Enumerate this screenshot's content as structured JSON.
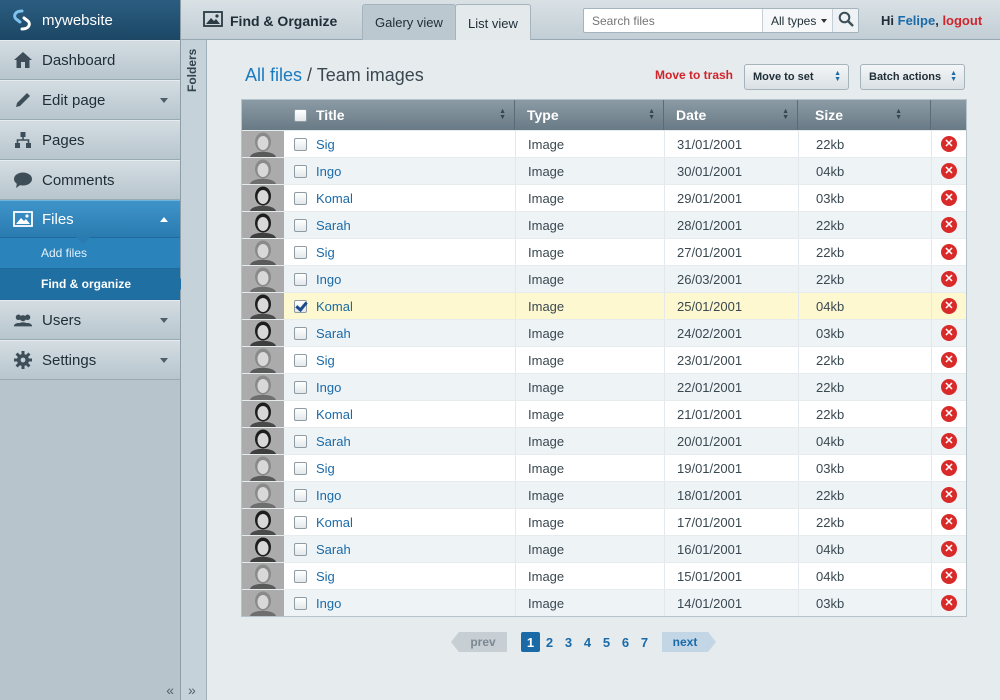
{
  "brand": {
    "name": "mywebsite"
  },
  "sidebar": {
    "items": [
      {
        "label": "Dashboard",
        "icon": "home-icon"
      },
      {
        "label": "Edit page",
        "icon": "pencil-icon"
      },
      {
        "label": "Pages",
        "icon": "sitemap-icon"
      },
      {
        "label": "Comments",
        "icon": "comment-icon"
      },
      {
        "label": "Files",
        "icon": "image-icon"
      },
      {
        "label": "Users",
        "icon": "users-icon"
      },
      {
        "label": "Settings",
        "icon": "gear-icon"
      }
    ],
    "files_sub": [
      {
        "label": "Add files"
      },
      {
        "label": "Find & organize"
      }
    ]
  },
  "folders": {
    "label": "Folders"
  },
  "header": {
    "title": "Find & Organize",
    "tab_gallery": "Galery view",
    "tab_list": "List view",
    "search_placeholder": "Search files",
    "type_select": "All types",
    "greeting_prefix": "Hi ",
    "user": "Felipe",
    "separator": ", ",
    "logout": "logout"
  },
  "main": {
    "breadcrumb_root": "All files",
    "breadcrumb_sep": " / ",
    "breadcrumb_current": "Team images",
    "move_trash": "Move to trash",
    "move_set": "Move to set",
    "batch_actions": "Batch actions"
  },
  "table": {
    "columns": [
      "Title",
      "Type",
      "Date",
      "Size"
    ],
    "rows": [
      {
        "title": "Sig",
        "type": "Image",
        "date": "31/01/2001",
        "size": "22kb",
        "checked": false
      },
      {
        "title": "Ingo",
        "type": "Image",
        "date": "30/01/2001",
        "size": "04kb",
        "checked": false
      },
      {
        "title": "Komal",
        "type": "Image",
        "date": "29/01/2001",
        "size": "03kb",
        "checked": false
      },
      {
        "title": "Sarah",
        "type": "Image",
        "date": "28/01/2001",
        "size": "22kb",
        "checked": false
      },
      {
        "title": "Sig",
        "type": "Image",
        "date": "27/01/2001",
        "size": "22kb",
        "checked": false
      },
      {
        "title": "Ingo",
        "type": "Image",
        "date": "26/03/2001",
        "size": "22kb",
        "checked": false
      },
      {
        "title": "Komal",
        "type": "Image",
        "date": "25/01/2001",
        "size": "04kb",
        "checked": true
      },
      {
        "title": "Sarah",
        "type": "Image",
        "date": "24/02/2001",
        "size": "03kb",
        "checked": false
      },
      {
        "title": "Sig",
        "type": "Image",
        "date": "23/01/2001",
        "size": "22kb",
        "checked": false
      },
      {
        "title": "Ingo",
        "type": "Image",
        "date": "22/01/2001",
        "size": "22kb",
        "checked": false
      },
      {
        "title": "Komal",
        "type": "Image",
        "date": "21/01/2001",
        "size": "22kb",
        "checked": false
      },
      {
        "title": "Sarah",
        "type": "Image",
        "date": "20/01/2001",
        "size": "04kb",
        "checked": false
      },
      {
        "title": "Sig",
        "type": "Image",
        "date": "19/01/2001",
        "size": "03kb",
        "checked": false
      },
      {
        "title": "Ingo",
        "type": "Image",
        "date": "18/01/2001",
        "size": "22kb",
        "checked": false
      },
      {
        "title": "Komal",
        "type": "Image",
        "date": "17/01/2001",
        "size": "22kb",
        "checked": false
      },
      {
        "title": "Sarah",
        "type": "Image",
        "date": "16/01/2001",
        "size": "04kb",
        "checked": false
      },
      {
        "title": "Sig",
        "type": "Image",
        "date": "15/01/2001",
        "size": "04kb",
        "checked": false
      },
      {
        "title": "Ingo",
        "type": "Image",
        "date": "14/01/2001",
        "size": "03kb",
        "checked": false
      }
    ]
  },
  "pagination": {
    "prev": "prev",
    "next": "next",
    "pages": [
      "1",
      "2",
      "3",
      "4",
      "5",
      "6",
      "7"
    ],
    "current": "1"
  },
  "colors": {
    "accent": "#2a7bb0",
    "link": "#1a6aa8",
    "danger": "#d0242b",
    "selected_row": "#fdf8cf"
  }
}
